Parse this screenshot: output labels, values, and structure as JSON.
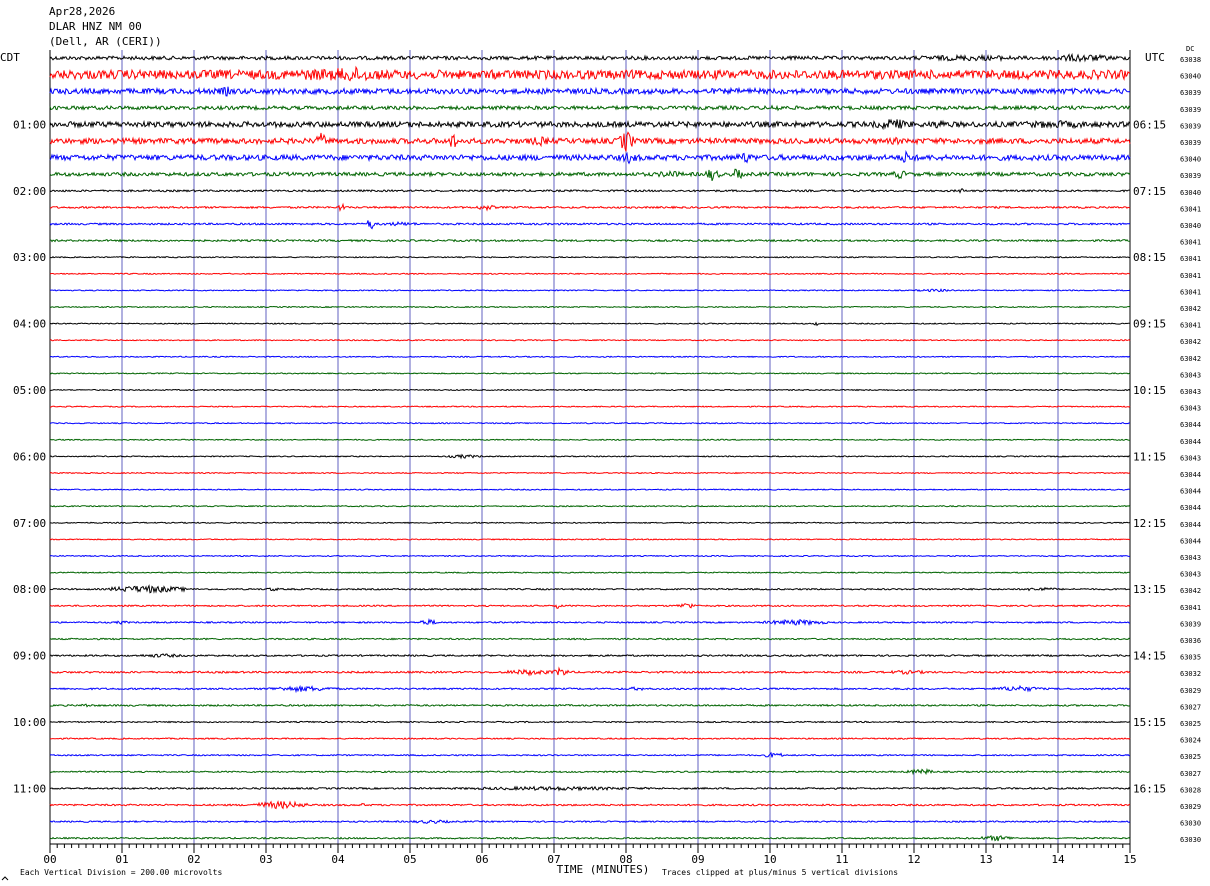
{
  "header": {
    "date": "Apr28,2026",
    "station": "DLAR HNZ NM 00",
    "location": "(Dell, AR (CERI))"
  },
  "left_zone": "CDT",
  "right_zone": "UTC",
  "dc_label": "DC",
  "footer": {
    "scale_note": "Each Vertical Division =  200.00 microvolts",
    "xlabel": "TIME (MINUTES)",
    "clip_note": "Traces clipped at plus/minus 5 vertical divisions"
  },
  "colors": {
    "trace_cycle": [
      "#000000",
      "#ff0000",
      "#0000ff",
      "#006400"
    ],
    "grid": "#6060c0",
    "axis": "#000000"
  },
  "chart_data": {
    "type": "line",
    "title": "",
    "xlabel": "TIME (MINUTES)",
    "xlim": [
      0,
      15
    ],
    "x_ticks": [
      "00",
      "01",
      "02",
      "03",
      "04",
      "05",
      "06",
      "07",
      "08",
      "09",
      "10",
      "11",
      "12",
      "13",
      "14",
      "15"
    ],
    "trace_interval_minutes": 15,
    "trace_count": 48,
    "left_hour_labels": [
      "01:00",
      "02:00",
      "03:00",
      "04:00",
      "05:00",
      "06:00",
      "07:00",
      "08:00",
      "09:00",
      "10:00",
      "11:00"
    ],
    "right_hour_labels": [
      "06:15",
      "07:15",
      "08:15",
      "09:15",
      "10:15",
      "11:15",
      "12:15",
      "13:15",
      "14:15",
      "15:15",
      "16:15"
    ],
    "dc_offsets": [
      63038,
      63040,
      63039,
      63039,
      63039,
      63039,
      63040,
      63039,
      63040,
      63041,
      63040,
      63041,
      63041,
      63041,
      63041,
      63042,
      63041,
      63042,
      63042,
      63043,
      63043,
      63043,
      63044,
      63044,
      63043,
      63044,
      63044,
      63044,
      63044,
      63044,
      63043,
      63043,
      63042,
      63041,
      63039,
      63036,
      63035,
      63032,
      63029,
      63027,
      63025,
      63024,
      63025,
      63027,
      63028,
      63029,
      63030,
      63030
    ],
    "activity": [
      {
        "trace": 0,
        "level": 2,
        "events": [
          [
            11.5,
            14.0,
            3
          ],
          [
            13.7,
            14.9,
            4
          ]
        ]
      },
      {
        "trace": 1,
        "level": 5,
        "events": [
          [
            2.4,
            5.2,
            6
          ],
          [
            3.6,
            4.8,
            8
          ],
          [
            6.0,
            6.5,
            4
          ],
          [
            13.5,
            14.5,
            3
          ]
        ]
      },
      {
        "trace": 2,
        "level": 3,
        "events": [
          [
            2.3,
            2.6,
            5
          ],
          [
            10.5,
            11.5,
            2
          ]
        ]
      },
      {
        "trace": 3,
        "level": 2,
        "events": [
          [
            10.0,
            10.2,
            4
          ]
        ]
      },
      {
        "trace": 4,
        "level": 3,
        "events": [
          [
            11.4,
            12.0,
            6
          ],
          [
            12.2,
            12.5,
            5
          ],
          [
            13.0,
            14.9,
            4
          ]
        ]
      },
      {
        "trace": 5,
        "level": 3,
        "events": [
          [
            3.7,
            3.85,
            9
          ],
          [
            5.55,
            5.65,
            10
          ],
          [
            6.6,
            7.0,
            5
          ],
          [
            7.9,
            8.1,
            12
          ],
          [
            11.6,
            11.9,
            4
          ]
        ]
      },
      {
        "trace": 6,
        "level": 3,
        "events": [
          [
            7.9,
            8.2,
            6
          ],
          [
            9.5,
            9.8,
            6
          ],
          [
            11.8,
            12.0,
            7
          ]
        ]
      },
      {
        "trace": 7,
        "level": 2,
        "events": [
          [
            8.4,
            8.8,
            4
          ],
          [
            9.1,
            9.3,
            7
          ],
          [
            9.5,
            9.6,
            9
          ],
          [
            11.7,
            11.9,
            5
          ]
        ]
      },
      {
        "trace": 8,
        "level": 1,
        "events": [
          [
            12.6,
            12.7,
            3
          ]
        ]
      },
      {
        "trace": 9,
        "level": 1,
        "events": [
          [
            4.0,
            4.1,
            5
          ],
          [
            5.9,
            6.2,
            3
          ]
        ]
      },
      {
        "trace": 10,
        "level": 1,
        "events": [
          [
            4.4,
            4.5,
            7
          ],
          [
            4.5,
            5.2,
            2
          ]
        ]
      },
      {
        "trace": 11,
        "level": 1,
        "events": []
      },
      {
        "trace": 12,
        "level": 0.6,
        "events": []
      },
      {
        "trace": 13,
        "level": 0.6,
        "events": []
      },
      {
        "trace": 14,
        "level": 0.6,
        "events": [
          [
            12.0,
            12.6,
            1.5
          ]
        ]
      },
      {
        "trace": 15,
        "level": 0.6,
        "events": []
      },
      {
        "trace": 16,
        "level": 0.6,
        "events": [
          [
            10.6,
            10.7,
            2
          ]
        ]
      },
      {
        "trace": 17,
        "level": 0.6,
        "events": []
      },
      {
        "trace": 18,
        "level": 0.6,
        "events": []
      },
      {
        "trace": 19,
        "level": 0.6,
        "events": []
      },
      {
        "trace": 20,
        "level": 0.6,
        "events": []
      },
      {
        "trace": 21,
        "level": 0.6,
        "events": []
      },
      {
        "trace": 22,
        "level": 0.6,
        "events": []
      },
      {
        "trace": 23,
        "level": 0.6,
        "events": []
      },
      {
        "trace": 24,
        "level": 0.6,
        "events": [
          [
            5.5,
            6.0,
            2
          ]
        ]
      },
      {
        "trace": 25,
        "level": 0.6,
        "events": []
      },
      {
        "trace": 26,
        "level": 0.6,
        "events": []
      },
      {
        "trace": 27,
        "level": 0.6,
        "events": []
      },
      {
        "trace": 28,
        "level": 0.6,
        "events": []
      },
      {
        "trace": 29,
        "level": 0.6,
        "events": []
      },
      {
        "trace": 30,
        "level": 0.6,
        "events": []
      },
      {
        "trace": 31,
        "level": 0.6,
        "events": []
      },
      {
        "trace": 32,
        "level": 0.8,
        "events": [
          [
            0.8,
            1.9,
            4
          ],
          [
            3.0,
            3.2,
            2
          ],
          [
            13.5,
            14.0,
            2
          ]
        ]
      },
      {
        "trace": 33,
        "level": 0.8,
        "events": [
          [
            7.0,
            7.1,
            3
          ],
          [
            8.7,
            9.0,
            3
          ]
        ]
      },
      {
        "trace": 34,
        "level": 0.8,
        "events": [
          [
            0.9,
            1.1,
            2
          ],
          [
            5.1,
            5.4,
            3
          ],
          [
            9.9,
            10.8,
            3
          ]
        ]
      },
      {
        "trace": 35,
        "level": 0.8,
        "events": []
      },
      {
        "trace": 36,
        "level": 0.9,
        "events": [
          [
            1.2,
            1.9,
            2
          ]
        ]
      },
      {
        "trace": 37,
        "level": 1,
        "events": [
          [
            6.3,
            7.0,
            3
          ],
          [
            7.0,
            7.2,
            5
          ],
          [
            11.5,
            12.3,
            2
          ]
        ]
      },
      {
        "trace": 38,
        "level": 0.9,
        "events": [
          [
            3.0,
            4.0,
            3
          ],
          [
            8.0,
            8.3,
            2
          ],
          [
            13.1,
            13.8,
            3
          ]
        ]
      },
      {
        "trace": 39,
        "level": 0.9,
        "events": [
          [
            0.4,
            0.6,
            2
          ]
        ]
      },
      {
        "trace": 40,
        "level": 0.7,
        "events": []
      },
      {
        "trace": 41,
        "level": 0.7,
        "events": []
      },
      {
        "trace": 42,
        "level": 0.7,
        "events": [
          [
            9.9,
            10.2,
            3
          ]
        ]
      },
      {
        "trace": 43,
        "level": 0.8,
        "events": [
          [
            11.9,
            12.3,
            3
          ]
        ]
      },
      {
        "trace": 44,
        "level": 0.9,
        "events": [
          [
            5.5,
            8.5,
            2
          ]
        ]
      },
      {
        "trace": 45,
        "level": 0.9,
        "events": [
          [
            2.8,
            3.6,
            4
          ],
          [
            4.3,
            4.4,
            2
          ]
        ]
      },
      {
        "trace": 46,
        "level": 0.8,
        "events": [
          [
            5.0,
            5.6,
            2
          ]
        ]
      },
      {
        "trace": 47,
        "level": 0.8,
        "events": [
          [
            12.9,
            13.4,
            3
          ]
        ]
      }
    ],
    "grid": true,
    "legend": "none"
  }
}
